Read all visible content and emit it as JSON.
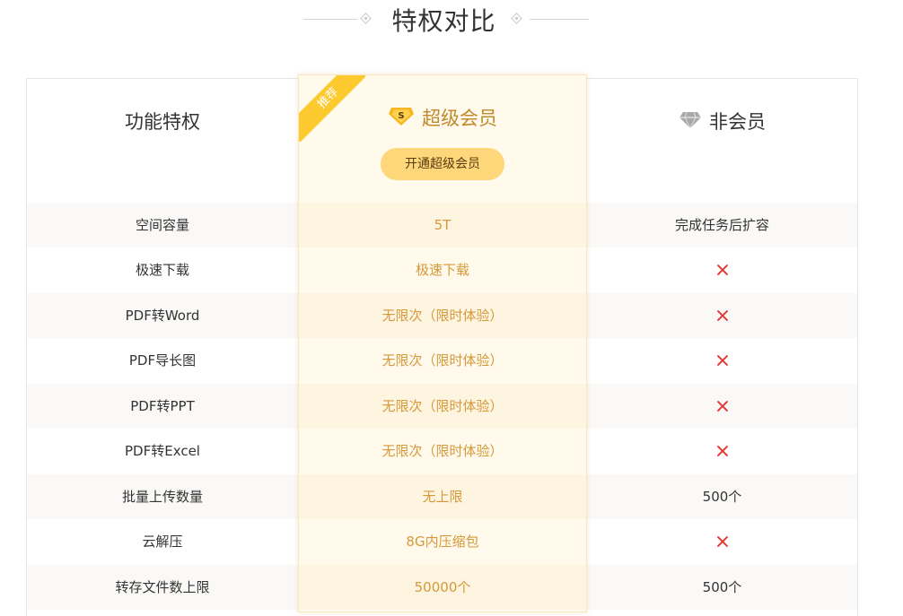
{
  "section": {
    "title": "特权对比"
  },
  "ribbon": "推荐",
  "columns": {
    "feature": "功能特权",
    "super": "超级会员",
    "non": "非会员"
  },
  "icons": {
    "super": "super-member-s-badge-icon",
    "non": "diamond-gray-icon",
    "unsupported": "red-cross-icon"
  },
  "colors": {
    "accent_gold": "#c08a2f",
    "button": "#fdd779",
    "ribbon": "#fcc92e",
    "cross": "#e33a36"
  },
  "open_button": "开通超级会员",
  "rows": [
    {
      "feature": "空间容量",
      "super": "5T",
      "non": "完成任务后扩容",
      "non_supported": true
    },
    {
      "feature": "极速下载",
      "super": "极速下载",
      "non": "",
      "non_supported": false
    },
    {
      "feature": "PDF转Word",
      "super": "无限次（限时体验）",
      "non": "",
      "non_supported": false
    },
    {
      "feature": "PDF导长图",
      "super": "无限次（限时体验）",
      "non": "",
      "non_supported": false
    },
    {
      "feature": "PDF转PPT",
      "super": "无限次（限时体验）",
      "non": "",
      "non_supported": false
    },
    {
      "feature": "PDF转Excel",
      "super": "无限次（限时体验）",
      "non": "",
      "non_supported": false
    },
    {
      "feature": "批量上传数量",
      "super": "无上限",
      "non": "500个",
      "non_supported": true
    },
    {
      "feature": "云解压",
      "super": "8G内压缩包",
      "non": "",
      "non_supported": false
    },
    {
      "feature": "转存文件数上限",
      "super": "50000个",
      "non": "500个",
      "non_supported": true
    }
  ]
}
